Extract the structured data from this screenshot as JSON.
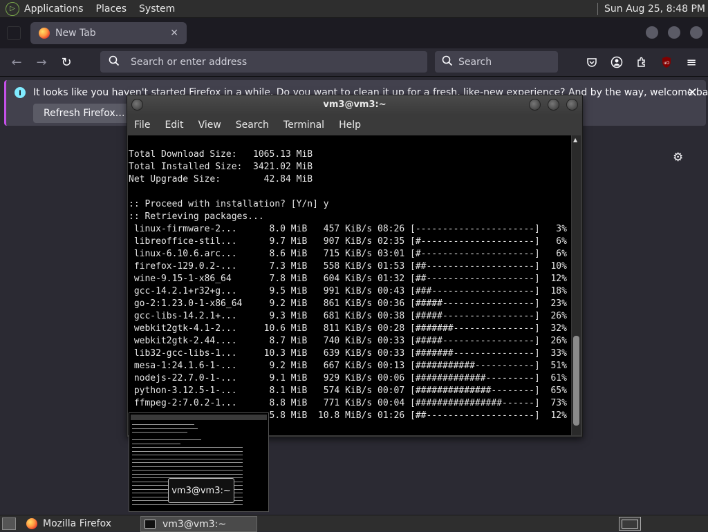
{
  "top_panel": {
    "menus": [
      "Applications",
      "Places",
      "System"
    ],
    "clock": "Sun Aug 25,  8:48 PM"
  },
  "firefox": {
    "tab_title": "New Tab",
    "urlbar_placeholder": "Search or enter address",
    "searchbar_placeholder": "Search",
    "notification": {
      "message": "It looks like you haven't started Firefox in a while. Do you want to clean it up for a fresh, like-new experience? And by the way, welcome back!",
      "button": "Refresh Firefox…"
    }
  },
  "terminal": {
    "title": "vm3@vm3:~",
    "menu": [
      "File",
      "Edit",
      "View",
      "Search",
      "Terminal",
      "Help"
    ],
    "lines": [
      "Total Download Size:   1065.13 MiB",
      "Total Installed Size:  3421.02 MiB",
      "Net Upgrade Size:        42.84 MiB",
      "",
      ":: Proceed with installation? [Y/n] y",
      ":: Retrieving packages...",
      " linux-firmware-2...      8.0 MiB   457 KiB/s 08:26 [----------------------]   3%",
      " libreoffice-stil...      9.7 MiB   907 KiB/s 02:35 [#---------------------]   6%",
      " linux-6.10.6.arc...      8.6 MiB   715 KiB/s 03:01 [#---------------------]   6%",
      " firefox-129.0.2-...      7.3 MiB   558 KiB/s 01:53 [##--------------------]  10%",
      " wine-9.15-1-x86_64       7.8 MiB   604 KiB/s 01:32 [##--------------------]  12%",
      " gcc-14.2.1+r32+g...      9.5 MiB   991 KiB/s 00:43 [###-------------------]  18%",
      " go-2:1.23.0-1-x86_64     9.2 MiB   861 KiB/s 00:36 [#####-----------------]  23%",
      " gcc-libs-14.2.1+...      9.3 MiB   681 KiB/s 00:38 [#####-----------------]  26%",
      " webkit2gtk-4.1-2...     10.6 MiB   811 KiB/s 00:28 [#######---------------]  32%",
      " webkit2gtk-2.44....      8.7 MiB   740 KiB/s 00:33 [#####-----------------]  26%",
      " lib32-gcc-libs-1...     10.3 MiB   639 KiB/s 00:33 [#######---------------]  33%",
      " mesa-1:24.1.6-1-...      9.2 MiB   667 KiB/s 00:13 [###########-----------]  51%",
      " nodejs-22.7.0-1-...      9.1 MiB   929 KiB/s 00:06 [#############---------]  61%",
      " python-3.12.5-1-...      8.1 MiB   574 KiB/s 00:07 [##############--------]  65%",
      " ffmpeg-2:7.0.2-1...      8.8 MiB   771 KiB/s 00:04 [################------]  73%",
      "                          5.8 MiB  10.8 MiB/s 01:26 [##--------------------]  12%"
    ]
  },
  "preview_label": "vm3@vm3:~",
  "taskbar": {
    "tasks": [
      "Mozilla Firefox",
      "vm3@vm3:~"
    ]
  }
}
